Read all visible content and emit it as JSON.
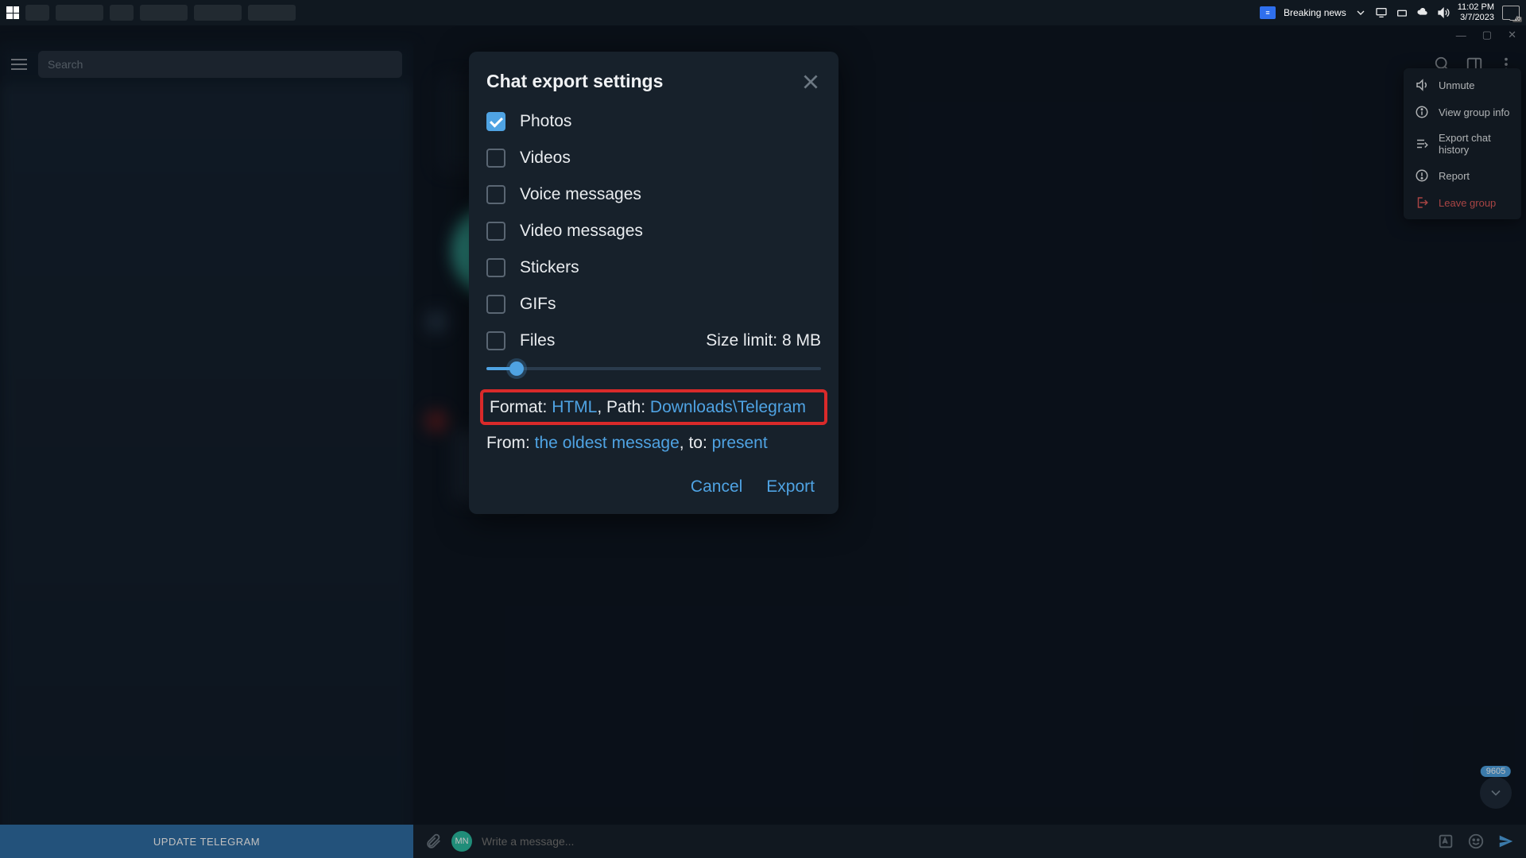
{
  "taskbar": {
    "news_label": "Breaking news",
    "time": "11:02 PM",
    "date": "3/7/2023",
    "notif_count": "10"
  },
  "sidebar": {
    "search_placeholder": "Search"
  },
  "topbar_menu": {
    "unmute": "Unmute",
    "group_info": "View group info",
    "export": "Export chat history",
    "report": "Report",
    "leave": "Leave group"
  },
  "modal": {
    "title": "Chat export settings",
    "items": {
      "photos": "Photos",
      "videos": "Videos",
      "voice": "Voice messages",
      "video_msg": "Video messages",
      "stickers": "Stickers",
      "gifs": "GIFs",
      "files": "Files"
    },
    "size_limit_label": "Size limit: 8 MB",
    "format_prefix": "Format: ",
    "format_value": "HTML",
    "path_prefix": ", Path: ",
    "path_value": "Downloads\\Telegram",
    "from_prefix": "From: ",
    "from_value": "the oldest message",
    "to_prefix": ", to: ",
    "to_value": "present",
    "cancel": "Cancel",
    "export": "Export"
  },
  "footer": {
    "update": "UPDATE TELEGRAM",
    "compose_placeholder": "Write a message...",
    "avatar_initials": "MN",
    "scroll_badge": "9605"
  }
}
